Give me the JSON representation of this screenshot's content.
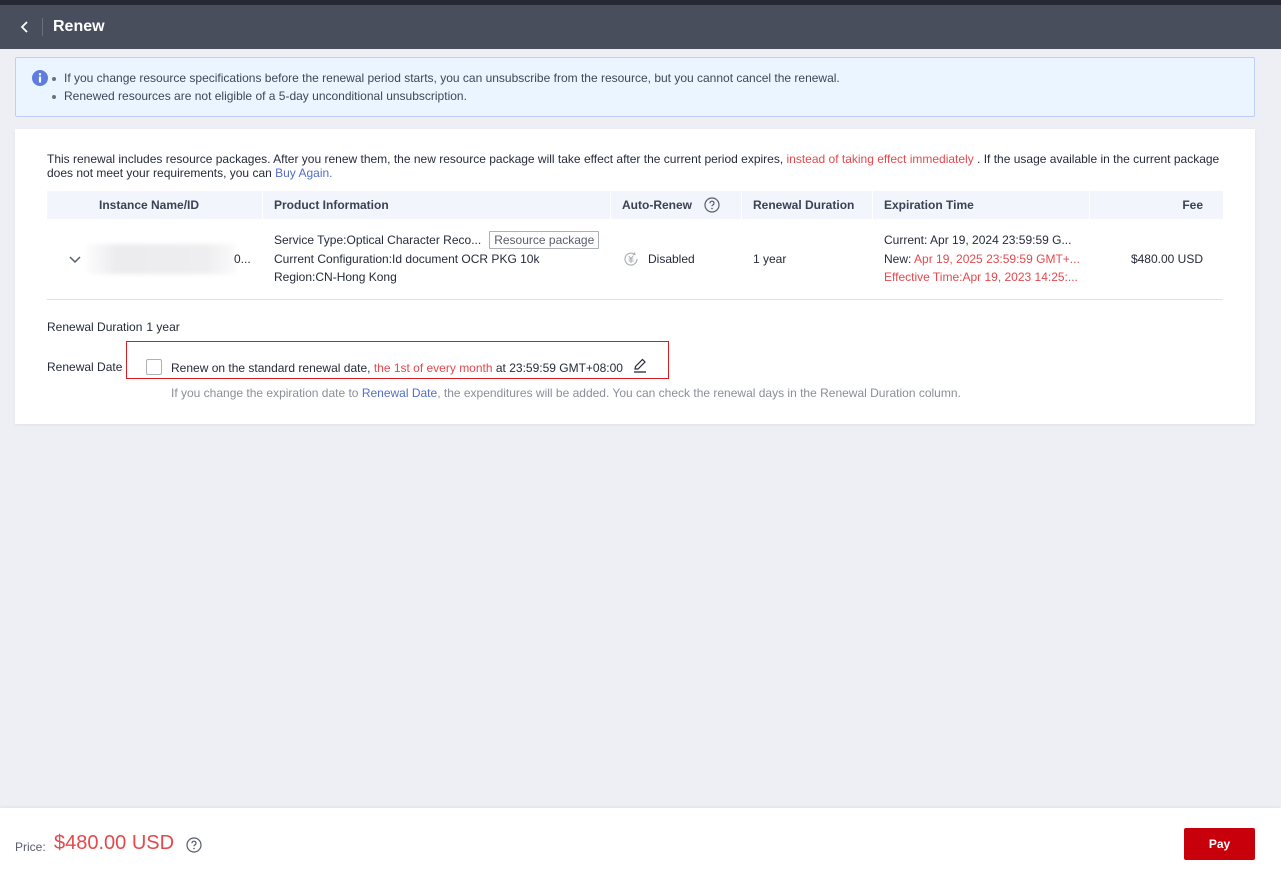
{
  "header": {
    "title": "Renew"
  },
  "notice": {
    "items": [
      "If you change resource specifications before the renewal period starts, you can unsubscribe from the resource, but you cannot cancel the renewal.",
      "Renewed resources are not eligible of a 5-day unconditional unsubscription."
    ]
  },
  "intro": {
    "part1": "This renewal includes resource packages. After you renew them, the new resource package will take effect after the current period expires, ",
    "highlight": "instead of taking effect immediately",
    "part2": " . If the usage available in the current package does not meet your requirements, you can ",
    "link": "Buy Again."
  },
  "table": {
    "columns": [
      "Instance Name/ID",
      "Product Information",
      "Auto-Renew",
      "Renewal Duration",
      "Expiration Time",
      "Fee"
    ],
    "rows": [
      {
        "instance_id_tail": "0...",
        "service_type": "Service Type:Optical Character Reco...",
        "tag": "Resource package",
        "configuration": "Current Configuration:Id document OCR PKG 10k",
        "region": "Region:CN-Hong Kong",
        "auto_renew": "Disabled",
        "duration": "1 year",
        "current_label": "Current: ",
        "current_value": "Apr 19, 2024 23:59:59 G...",
        "new_label": "New: ",
        "new_value": "Apr 19, 2025 23:59:59 GMT+...",
        "effective": "Effective Time:Apr 19, 2023 14:25:...",
        "fee": "$480.00 USD"
      }
    ]
  },
  "renewal": {
    "duration_label": "Renewal Duration",
    "duration_value": "1 year",
    "date_label": "Renewal Date",
    "date_text1": "Renew on the standard renewal date, ",
    "date_highlight": "the 1st of every month",
    "date_text2": " at 23:59:59 GMT+08:00",
    "hint1": "If you change the expiration date to ",
    "hint_link": "Renewal Date",
    "hint2": ", the expenditures will be added. You can check the renewal days in the Renewal Duration column.",
    "checked": false
  },
  "footer": {
    "price_label": "Price:",
    "price_value": "$480.00 USD",
    "pay_label": "Pay"
  },
  "colors": {
    "accent": "#c7000b",
    "warning_text": "#e5484d",
    "link": "#526ecc",
    "header_bg": "#484e5c"
  }
}
